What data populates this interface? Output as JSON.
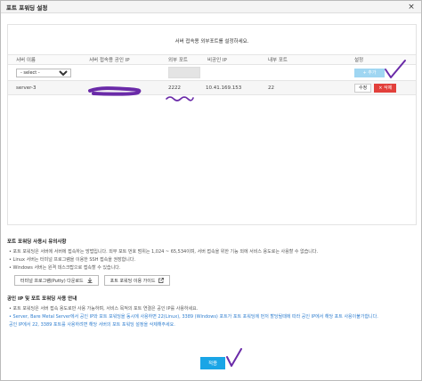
{
  "dialog": {
    "title": "포트 포워딩 설정",
    "close_glyph": "×"
  },
  "panel": {
    "message": "서버 접속용 외부포트를 설정하세요.",
    "columns": [
      "서버 이름",
      "서버 접속용 공인 IP",
      "외부 포트",
      "비공인 IP",
      "내부 포트",
      "설정"
    ],
    "select_value": "- select -",
    "add_label": "+ 추가",
    "row": {
      "server_name": "server-3",
      "external_port": "2222",
      "private_ip": "10.41.169.153",
      "internal_port": "22",
      "edit_label": "수정",
      "delete_label": "× 삭제"
    }
  },
  "notes": {
    "section1_title": "포트 포워딩 사용시 유의사항",
    "section1_items": [
      "포트 포워딩은 서버에 서버에 접속하는 방법입니다. 외부 포트 번호 범위는 1,024 ~ 65,534이며, 서버 접속을 위한 기능 외에 서비스 용도로는 사용할 수 없습니다.",
      "Linux 서버는 터미널 프로그램을 이용한 SSH 접속을 권장합니다.",
      "Windows 서버는 원격 데스크탑으로 접속할 수 있습니다."
    ],
    "button_putty": "터미널 프로그램(Putty) 다운로드",
    "button_guide": "포트 포워딩 이용 가이드",
    "section2_title": "공인 IP 및 포트 포워딩 사용 안내",
    "section2_items": [
      "포트 포워딩은 서버 접속 용도로만 사용 가능하며, 서비스 목적의 포트 연결은 공인 IP를 사용하세요.",
      "Server, Bare Metal Server에서 공인 IP와 포트 포워딩을 동시에 사용하면 22(Linux), 3389 (Windows) 포트가 포트 포워딩에 먼저 할당될때에 따라 공인 IP에서 해당 포트 사용이불가합니다.",
      "공인 IP에서 22, 3389 포트를 사용하려면 해당 서버의 포트 포워딩 설정을 삭제해주세요."
    ]
  },
  "footer": {
    "apply_label": "적용"
  },
  "colors": {
    "apply": "#1aa5e6",
    "delete": "#e2403b",
    "add": "#9fd6f2",
    "annotation": "#6a2aa8"
  }
}
